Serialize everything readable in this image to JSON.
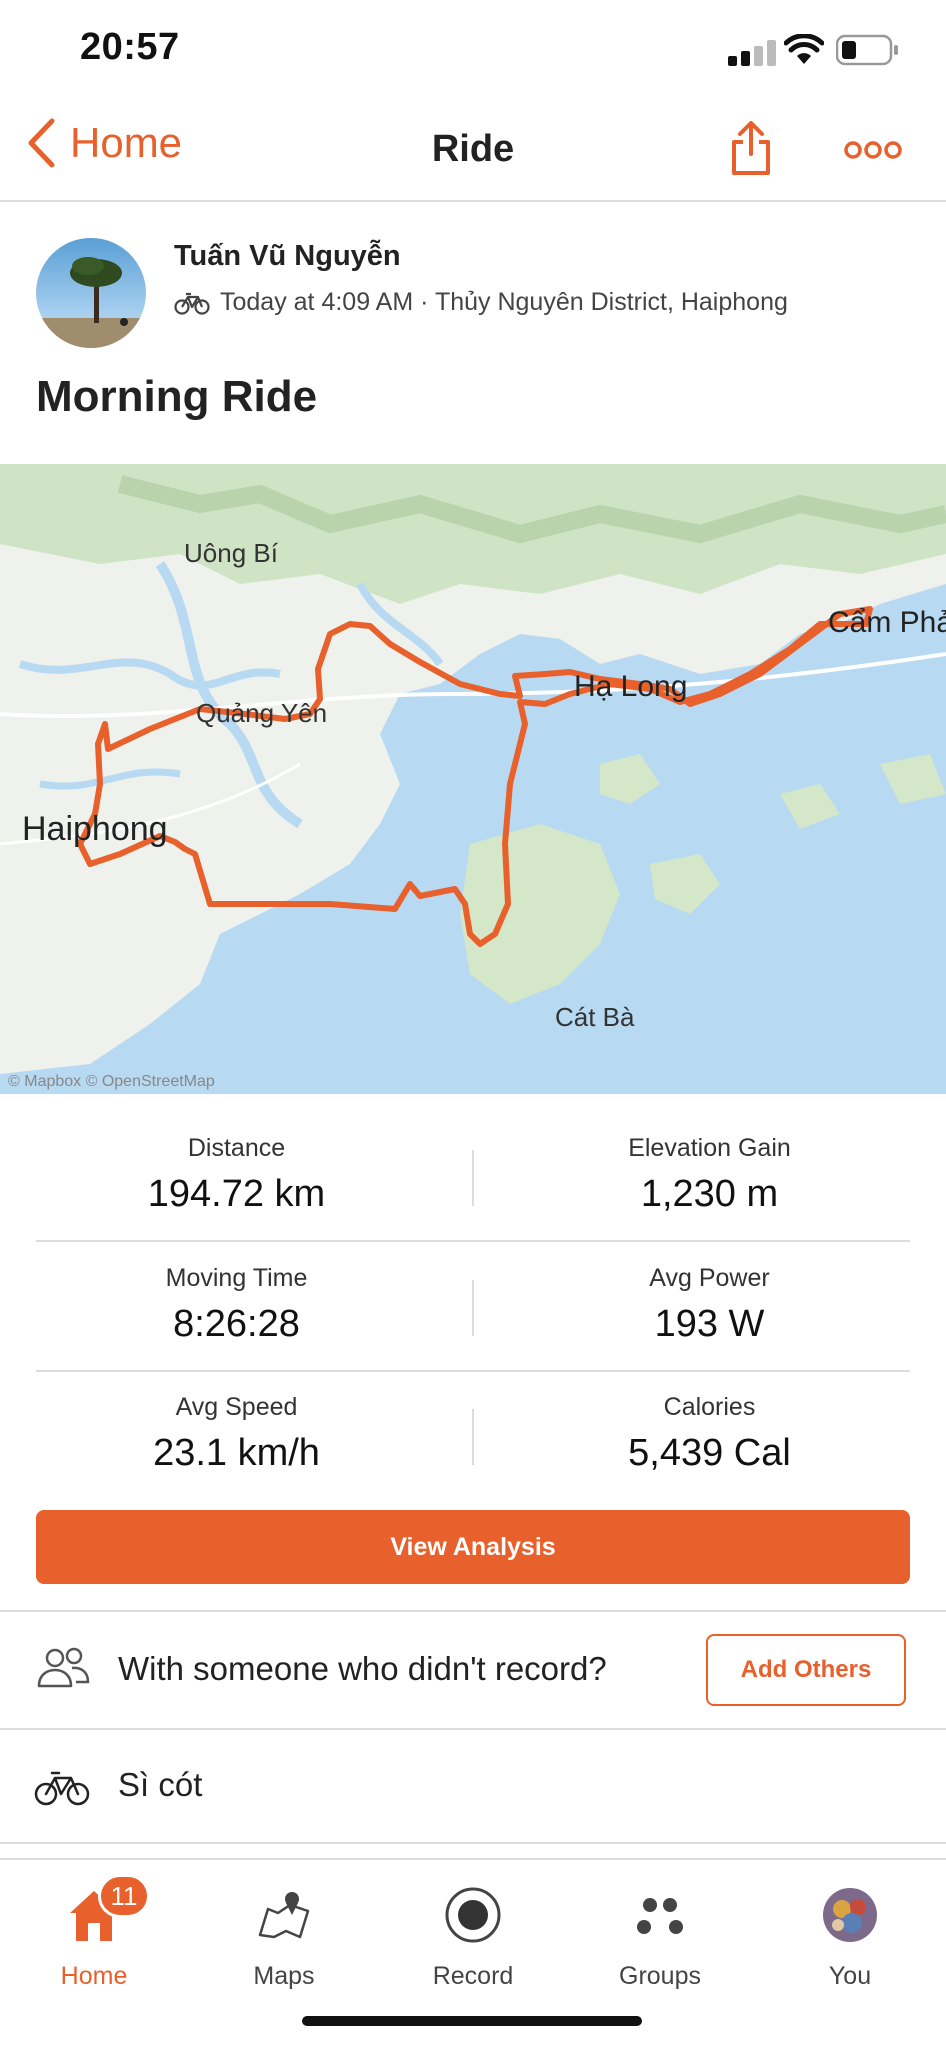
{
  "status_bar": {
    "time": "20:57"
  },
  "nav": {
    "back_label": "Home",
    "title": "Ride"
  },
  "athlete": {
    "name": "Tuấn Vũ Nguyễn",
    "meta": "Today at 4:09 AM · Thủy Nguyên District, Haiphong"
  },
  "activity": {
    "title": "Morning Ride"
  },
  "map": {
    "labels": {
      "uong_bi": "Uông Bí",
      "quang_yen": "Quảng Yên",
      "haiphong": "Haiphong",
      "ha_long": "Hạ Long",
      "cam_pha": "Cẩm Phả",
      "cat_ba": "Cát Bà"
    },
    "attribution": "© Mapbox © OpenStreetMap"
  },
  "stats": {
    "distance": {
      "label": "Distance",
      "value": "194.72 km"
    },
    "elevation": {
      "label": "Elevation Gain",
      "value": "1,230 m"
    },
    "moving_time": {
      "label": "Moving Time",
      "value": "8:26:28"
    },
    "avg_power": {
      "label": "Avg Power",
      "value": "193 W"
    },
    "avg_speed": {
      "label": "Avg Speed",
      "value": "23.1 km/h"
    },
    "calories": {
      "label": "Calories",
      "value": "5,439 Cal"
    }
  },
  "actions": {
    "view_analysis": "View Analysis",
    "with_someone": "With someone who didn't record?",
    "add_others": "Add Others"
  },
  "gear": {
    "name": "Sì cót"
  },
  "tabbar": {
    "home": "Home",
    "home_badge": "11",
    "maps": "Maps",
    "record": "Record",
    "groups": "Groups",
    "you": "You"
  },
  "colors": {
    "accent": "#e8602c",
    "water": "#b7d9f2",
    "land": "#eef1ec",
    "forest": "#cfe3c5"
  },
  "icons": [
    "cellular-icon",
    "wifi-icon",
    "battery-icon",
    "chevron-left-icon",
    "share-icon",
    "more-icon",
    "bike-icon",
    "people-icon",
    "home-icon",
    "maps-icon",
    "record-icon",
    "groups-icon"
  ]
}
